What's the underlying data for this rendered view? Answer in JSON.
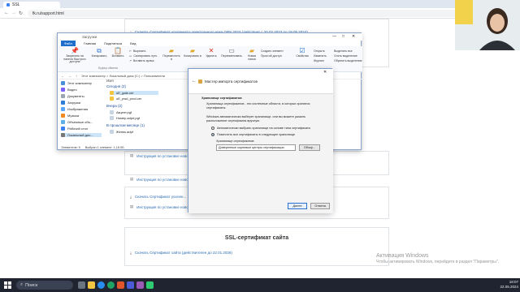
{
  "browser": {
    "tab_title": "SSL",
    "url": "fk.ru/support.html"
  },
  "page": {
    "links": [
      {
        "text": "Скачать Сертификат усиленного электронного чека ОФУ 2023 (действует с 20.02.2023 по 19.05.2024)"
      },
      {
        "text": "Инструкция по установке нового..."
      },
      {
        "text": "Инструкция по установке нового..."
      },
      {
        "text": "Скачать Сертификат усилен..."
      },
      {
        "text": "Инструкция по установке нового..."
      }
    ],
    "ssl_title": "SSL-сертификат сайта",
    "ssl_link": "Скачать Сертификат сайта (действителен до 22.01.2026)"
  },
  "explorer": {
    "title": "Загрузки",
    "menu": [
      "Файл",
      "Главная",
      "Поделиться",
      "Вид"
    ],
    "ribbon": {
      "pin": "Закрепить на панели быстрого доступа",
      "copy": "Копировать",
      "paste": "Вставить",
      "cut": "Вырезать",
      "copy_path": "Скопировать путь",
      "paste_shortcut": "Вставить ярлык",
      "move_to": "Переместить в",
      "copy_to": "Копировать в",
      "delete": "Удалить",
      "rename": "Переименовать",
      "new_folder": "Новая папка",
      "new_item": "Создать элемент",
      "easy_access": "Простой доступ",
      "properties": "Свойства",
      "open": "Открыть",
      "edit": "Изменить",
      "history": "Журнал",
      "select_all": "Выделить все",
      "select_none": "Снять выделение",
      "invert": "Обратить выделение",
      "clipboard_group": "Буфер обмена"
    },
    "address": "Этот компьютер > Локальный диск (C:) > Пользователи",
    "nav": [
      "Этот компьютер",
      "Видео",
      "Документы",
      "Загрузки",
      "Изображения",
      "Музыка",
      "Объемные объ...",
      "Рабочий стол",
      "Локальный дис..."
    ],
    "groups": [
      {
        "label": "Сегодня (2)",
        "files": [
          "oE_gate.cer",
          "oE_pwd_prod.cer"
        ]
      },
      {
        "label": "Вчера (2)",
        "files": [
          "Акцепт.pgf",
          "Номер.adpd.pgf"
        ]
      },
      {
        "label": "В прошлом месяце (1)",
        "files": [
          "Женек.adpf"
        ]
      }
    ],
    "col_header": "Имя",
    "status": [
      "Элементов: 5",
      "Выбран 1 элемент: 1,18 КБ"
    ]
  },
  "wizard": {
    "title": "Мастер импорта сертификатов",
    "heading": "Хранилище сертификатов",
    "subheading": "Хранилища сертификатов - это системные области, в которых хранятся сертификаты.",
    "body": "Windows автоматически выберет хранилище, или вы можете указать расположение сертификата вручную.",
    "option_auto": "Автоматически выбрать хранилище на основе типа сертификата",
    "option_manual": "Поместить все сертификаты в следующее хранилище",
    "store_label": "Хранилище сертификатов:",
    "store_value": "Доверенные корневые центры сертификации",
    "browse": "Обзор...",
    "next": "Далее",
    "cancel": "Отмена"
  },
  "watermark": {
    "line1": "Активация Windows",
    "line2": "Чтобы активировать Windows, перейдите в раздел \"Параметры\"."
  },
  "taskbar": {
    "search": "Поиск",
    "time": "18:07",
    "date": "22.05.2024"
  }
}
